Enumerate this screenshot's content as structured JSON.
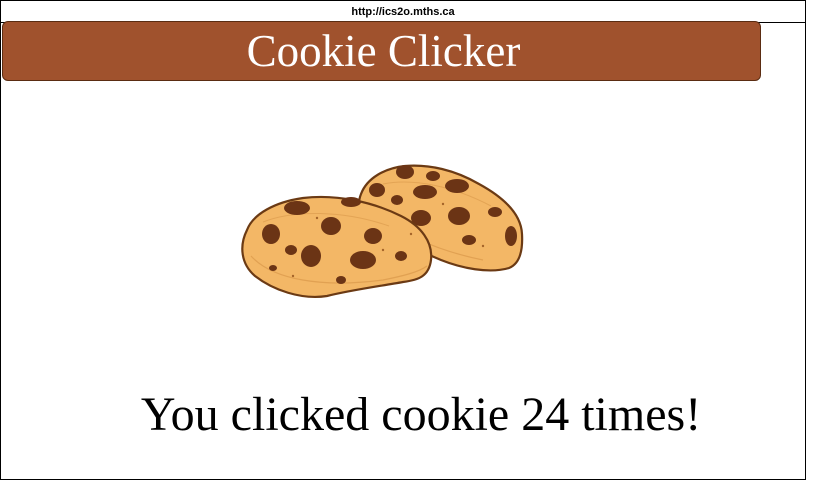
{
  "browser": {
    "url": "http://ics2o.mths.ca"
  },
  "header": {
    "title": "Cookie Clicker",
    "color": "#a0522d"
  },
  "cookie": {
    "icon": "cookies-icon",
    "dough_color": "#f2b565",
    "edge_color": "#6b3a14",
    "chip_color": "#6b3415"
  },
  "message": {
    "prefix": "You clicked cookie ",
    "count": "24",
    "suffix": " times!"
  }
}
